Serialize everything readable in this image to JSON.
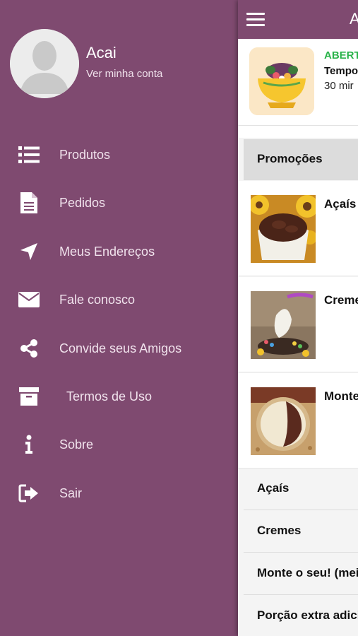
{
  "colors": {
    "brand": "#7f4a70",
    "open_status": "#2ab34a"
  },
  "drawer": {
    "user_name": "Acai",
    "account_link": "Ver minha conta",
    "items": [
      {
        "label": "Produtos",
        "icon": "list-icon"
      },
      {
        "label": "Pedidos",
        "icon": "document-icon"
      },
      {
        "label": "Meus Endereços",
        "icon": "location-arrow-icon"
      },
      {
        "label": "Fale conosco",
        "icon": "envelope-icon"
      },
      {
        "label": "Convide seus Amigos",
        "icon": "share-icon"
      },
      {
        "label": "Termos de Uso",
        "icon": "archive-icon"
      },
      {
        "label": "Sobre",
        "icon": "info-icon"
      },
      {
        "label": "Sair",
        "icon": "sign-out-icon"
      }
    ]
  },
  "main": {
    "title": "A",
    "store": {
      "status": "ABERT",
      "time_label": "Tempo",
      "time_value": "30 mir"
    },
    "section_title": "Promoções",
    "products": [
      {
        "name": "Açaís ("
      },
      {
        "name": "Creme"
      },
      {
        "name": "Monte g)"
      }
    ],
    "categories": [
      "Açaís",
      "Cremes",
      "Monte o seu! (mei",
      "Porção extra adici"
    ]
  }
}
